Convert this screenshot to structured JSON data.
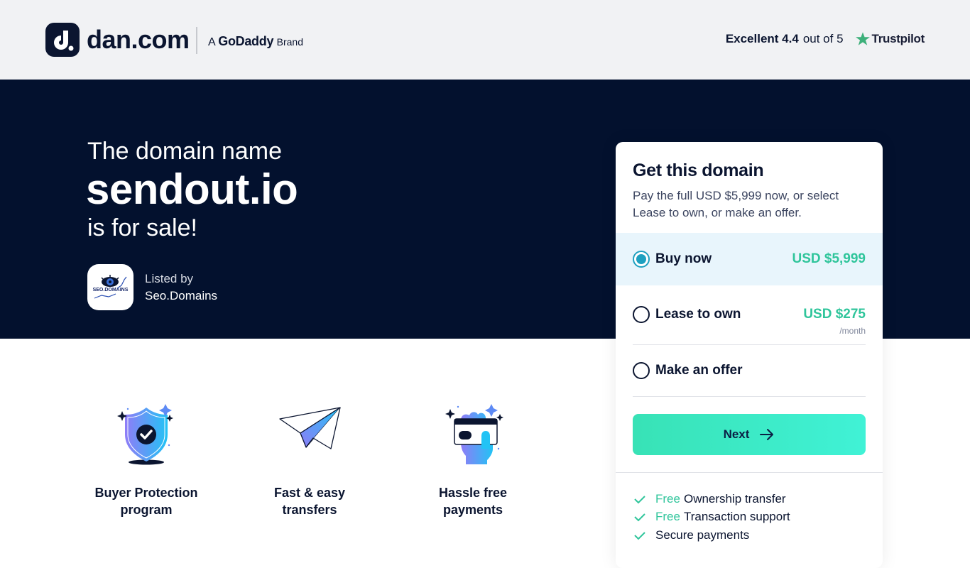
{
  "header": {
    "logo_text": "dan.com",
    "brand_prefix": "A",
    "brand_name": "GoDaddy",
    "brand_suffix": "Brand",
    "rating_label": "Excellent 4.4",
    "rating_scale": "out of 5",
    "rating_value": 4.4,
    "rating_max": 5,
    "trustpilot_label": "Trustpilot",
    "icons": {
      "logo": "dan-logo-icon",
      "star": "trustpilot-star-icon"
    }
  },
  "hero": {
    "intro": "The domain name",
    "domain": "sendout.io",
    "outro": "is for sale!",
    "seller": {
      "label": "Listed by",
      "name": "Seo.Domains",
      "logo_text": "SEO.DOMAINS"
    }
  },
  "features": [
    {
      "label_line1": "Buyer Protection",
      "label_line2": "program",
      "icon": "shield-check-icon"
    },
    {
      "label_line1": "Fast & easy",
      "label_line2": "transfers",
      "icon": "paper-plane-icon"
    },
    {
      "label_line1": "Hassle free",
      "label_line2": "payments",
      "icon": "hand-card-icon"
    }
  ],
  "card": {
    "title": "Get this domain",
    "description": "Pay the full USD $5,999 now, or select Lease to own, or make an offer.",
    "options": [
      {
        "label": "Buy now",
        "price": "USD $5,999",
        "sub": "",
        "selected": true
      },
      {
        "label": "Lease to own",
        "price": "USD $275",
        "sub": "/month",
        "selected": false
      },
      {
        "label": "Make an offer",
        "price": "",
        "sub": "",
        "selected": false
      }
    ],
    "next_label": "Next",
    "perks": [
      {
        "highlight": "Free",
        "text": "Ownership transfer"
      },
      {
        "highlight": "Free",
        "text": "Transaction support"
      },
      {
        "highlight": "",
        "text": "Secure payments"
      }
    ]
  },
  "colors": {
    "navy": "#03112e",
    "text_dark": "#0b1530",
    "accent_green": "#2fc59b",
    "radio_selected": "#1ea0c0",
    "selected_bg": "#e8f5fc",
    "button_gradient_start": "#38e2b6",
    "button_gradient_end": "#40f2d6",
    "trustpilot_green": "#3db07a"
  }
}
